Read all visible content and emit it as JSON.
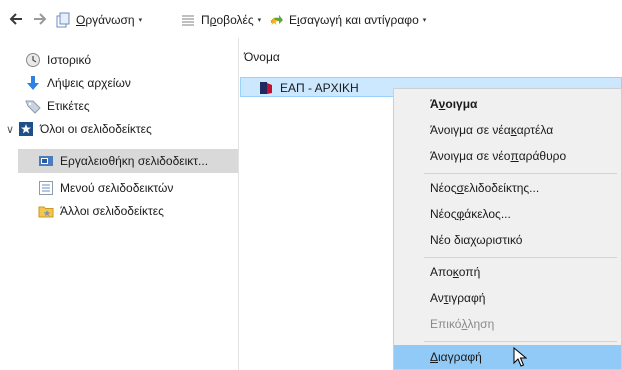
{
  "toolbar": {
    "back_icon": "back-arrow-icon",
    "forward_icon": "forward-arrow-icon",
    "organize": {
      "pre": "",
      "acc": "Ο",
      "post": "ργάνωση"
    },
    "views": {
      "pre": "Π",
      "acc": "ρ",
      "post": "οβολές"
    },
    "import": {
      "pre": "Ε",
      "acc": "ι",
      "post": "σαγωγή και αντίγραφο"
    },
    "dropdown_caret": "▾"
  },
  "sidebar": {
    "items": [
      {
        "label": "Ιστορικό",
        "icon": "clock-icon"
      },
      {
        "label": "Λήψεις αρχείων",
        "icon": "download-arrow-icon"
      },
      {
        "label": "Ετικέτες",
        "icon": "tag-icon"
      },
      {
        "label": "Όλοι οι σελιδοδείκτες",
        "icon": "star-bookmark-icon",
        "expander": "∨"
      },
      {
        "label": "Εργαλειοθήκη σελιδοδεικτ...",
        "icon": "toolbar-bookmarks-icon",
        "selected": true
      },
      {
        "label": "Μενού σελιδοδεικτών",
        "icon": "menu-bookmarks-icon"
      },
      {
        "label": "Άλλοι σελιδοδείκτες",
        "icon": "folder-bookmarks-icon"
      }
    ]
  },
  "list": {
    "column_name": "Όνομα",
    "rows": [
      {
        "label": "ΕΑΠ - ΑΡΧΙΚΗ",
        "icon": "site-favicon-icon"
      }
    ]
  },
  "context_menu": {
    "items": [
      {
        "pre": "Ά",
        "acc": "ν",
        "post": "οιγμα",
        "bold": true
      },
      {
        "pre": "Άνοιγμα σε νέα ",
        "acc": "κ",
        "post": "αρτέλα"
      },
      {
        "pre": "Άνοιγμα σε νέο ",
        "acc": "π",
        "post": "αράθυρο"
      },
      {
        "separator": true
      },
      {
        "pre": "Νέος ",
        "acc": "σ",
        "post": "ελιδοδείκτης..."
      },
      {
        "pre": "Νέος ",
        "acc": "φ",
        "post": "άκελος..."
      },
      {
        "pre": "Νέο διαχωριστικό",
        "acc": "",
        "post": ""
      },
      {
        "separator": true
      },
      {
        "pre": "Απο",
        "acc": "κ",
        "post": "οπή"
      },
      {
        "pre": "Αν",
        "acc": "τ",
        "post": "ιγραφή"
      },
      {
        "pre": "Επικό",
        "acc": "λ",
        "post": "ληση",
        "disabled": true
      },
      {
        "separator": true
      },
      {
        "pre": "",
        "acc": "Δ",
        "post": "ιαγραφή",
        "hover": true
      }
    ]
  },
  "colors": {
    "selection_row": "#cce8ff",
    "menu_hover": "#91c9f7",
    "sidebar_selected": "#d9d9d9"
  }
}
